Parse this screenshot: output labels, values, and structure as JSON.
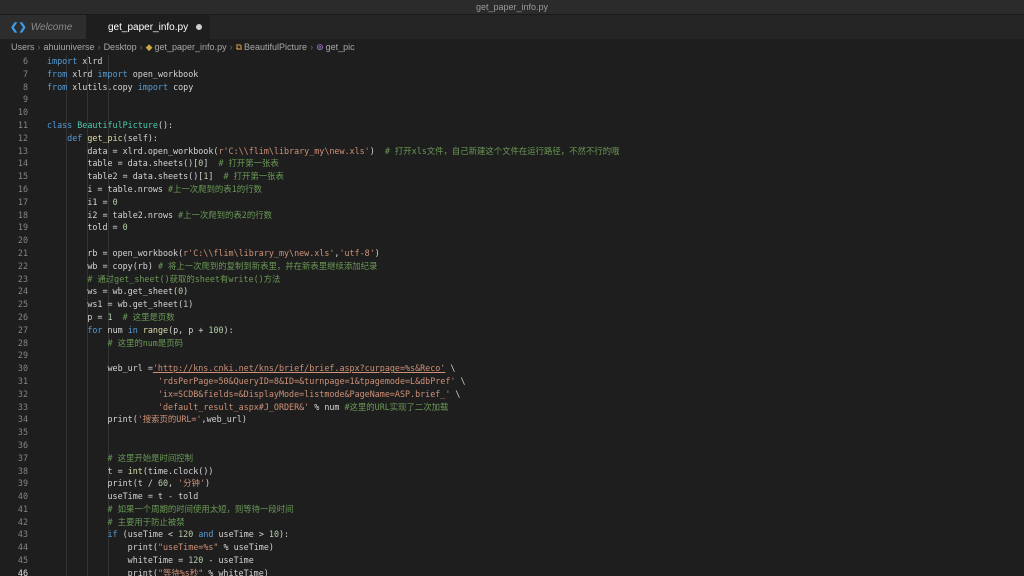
{
  "window": {
    "title": "get_paper_info.py"
  },
  "tabs": [
    {
      "label": "Welcome",
      "active": false
    },
    {
      "label": "get_paper_info.py",
      "active": true,
      "modified": true
    }
  ],
  "breadcrumb": [
    "Users",
    "ahuiuniverse",
    "Desktop",
    "get_paper_info.py",
    "BeautifulPicture",
    "get_pic"
  ],
  "editor": {
    "current_line": 46,
    "lines": [
      {
        "n": "6",
        "html": "<span class=\"kw\">import</span> xlrd"
      },
      {
        "n": "7",
        "html": "<span class=\"kw\">from</span> xlrd <span class=\"kw\">import</span> open_workbook"
      },
      {
        "n": "8",
        "html": "<span class=\"kw\">from</span> xlutils.copy <span class=\"kw\">import</span> copy"
      },
      {
        "n": "9",
        "html": ""
      },
      {
        "n": "10",
        "html": ""
      },
      {
        "n": "11",
        "html": "<span class=\"kw\">class</span> <span class=\"cls\">BeautifulPicture</span>():"
      },
      {
        "n": "12",
        "html": "    <span class=\"kw\">def</span> <span class=\"fn\">get_pic</span>(self):"
      },
      {
        "n": "13",
        "html": "        data = xlrd.open_workbook(<span class=\"str\">r'C:\\\\flim\\library_my\\new.xls'</span>)  <span class=\"cmt\"># 打开xls文件，自己新建这个文件在运行路径，不然不行的哦</span>"
      },
      {
        "n": "14",
        "html": "        table = data.sheets()[<span class=\"num\">0</span>]  <span class=\"cmt\"># 打开第一张表</span>"
      },
      {
        "n": "15",
        "html": "        table2 = data.sheets()[<span class=\"num\">1</span>]  <span class=\"cmt\"># 打开第一张表</span>"
      },
      {
        "n": "16",
        "html": "        i = table.nrows <span class=\"cmt\">#上一次爬到的表1的行数</span>"
      },
      {
        "n": "17",
        "html": "        i1 = <span class=\"num\">0</span>"
      },
      {
        "n": "18",
        "html": "        i2 = table2.nrows <span class=\"cmt\">#上一次爬到的表2的行数</span>"
      },
      {
        "n": "19",
        "html": "        told = <span class=\"num\">0</span>"
      },
      {
        "n": "20",
        "html": ""
      },
      {
        "n": "21",
        "html": "        rb = open_workbook(<span class=\"str\">r'C:\\\\flim\\library_my\\new.xls'</span>,<span class=\"str\">'utf-8'</span>)"
      },
      {
        "n": "22",
        "html": "        wb = copy(rb) <span class=\"cmt\"># 将上一次爬到的复制到新表里，并在新表里继续添加纪录</span>"
      },
      {
        "n": "23",
        "html": "        <span class=\"cmt\"># 通过get_sheet()获取的sheet有write()方法</span>"
      },
      {
        "n": "24",
        "html": "        ws = wb.get_sheet(<span class=\"num\">0</span>)"
      },
      {
        "n": "25",
        "html": "        ws1 = wb.get_sheet(<span class=\"num\">1</span>)"
      },
      {
        "n": "26",
        "html": "        p = <span class=\"num\">1</span>  <span class=\"cmt\"># 这里是页数</span>"
      },
      {
        "n": "27",
        "html": "        <span class=\"kw\">for</span> num <span class=\"kw\">in</span> <span class=\"fn\">range</span>(p, p + <span class=\"num\">100</span>):"
      },
      {
        "n": "28",
        "html": "            <span class=\"cmt\"># 这里的num是页码</span>"
      },
      {
        "n": "29",
        "html": ""
      },
      {
        "n": "30",
        "html": "            web_url =<span class=\"url\">'http://kns.cnki.net/kns/brief/brief.aspx?curpage=%s&amp;Reco'</span> \\"
      },
      {
        "n": "31",
        "html": "                      <span class=\"str\">'rdsPerPage=50&amp;QueryID=8&amp;ID=&amp;turnpage=1&amp;tpagemode=L&amp;dbPref'</span> \\"
      },
      {
        "n": "32",
        "html": "                      <span class=\"str\">'ix=SCDB&amp;fields=&amp;DisplayMode=listmode&amp;PageName=ASP.brief_'</span> \\"
      },
      {
        "n": "33",
        "html": "                      <span class=\"str\">'default_result_aspx#J_ORDER&amp;'</span> % num <span class=\"cmt\">#这里的URL实现了二次加载</span>"
      },
      {
        "n": "34",
        "html": "            print(<span class=\"str\">'搜索页的URL='</span>,web_url)"
      },
      {
        "n": "35",
        "html": ""
      },
      {
        "n": "36",
        "html": ""
      },
      {
        "n": "37",
        "html": "            <span class=\"cmt\"># 这里开始是时间控制</span>"
      },
      {
        "n": "38",
        "html": "            t = <span class=\"fn\">int</span>(time.clock())"
      },
      {
        "n": "39",
        "html": "            print(t / <span class=\"num\">60</span>, <span class=\"str\">'分钟'</span>)"
      },
      {
        "n": "40",
        "html": "            useTime = t - told"
      },
      {
        "n": "41",
        "html": "            <span class=\"cmt\"># 如果一个周期的时间使用太短，则等待一段时间</span>"
      },
      {
        "n": "42",
        "html": "            <span class=\"cmt\"># 主要用于防止被禁</span>"
      },
      {
        "n": "43",
        "html": "            <span class=\"kw\">if</span> (useTime &lt; <span class=\"num\">120</span> <span class=\"kw\">and</span> useTime &gt; <span class=\"num\">10</span>):"
      },
      {
        "n": "44",
        "html": "                print(<span class=\"str\">\"useTime=%s\"</span> % useTime)"
      },
      {
        "n": "45",
        "html": "                whiteTime = <span class=\"num\">120</span> - useTime"
      },
      {
        "n": "46",
        "html": "                print(<span class=\"str\">\"等待%s秒\"</span> % whiteTime)"
      }
    ]
  }
}
